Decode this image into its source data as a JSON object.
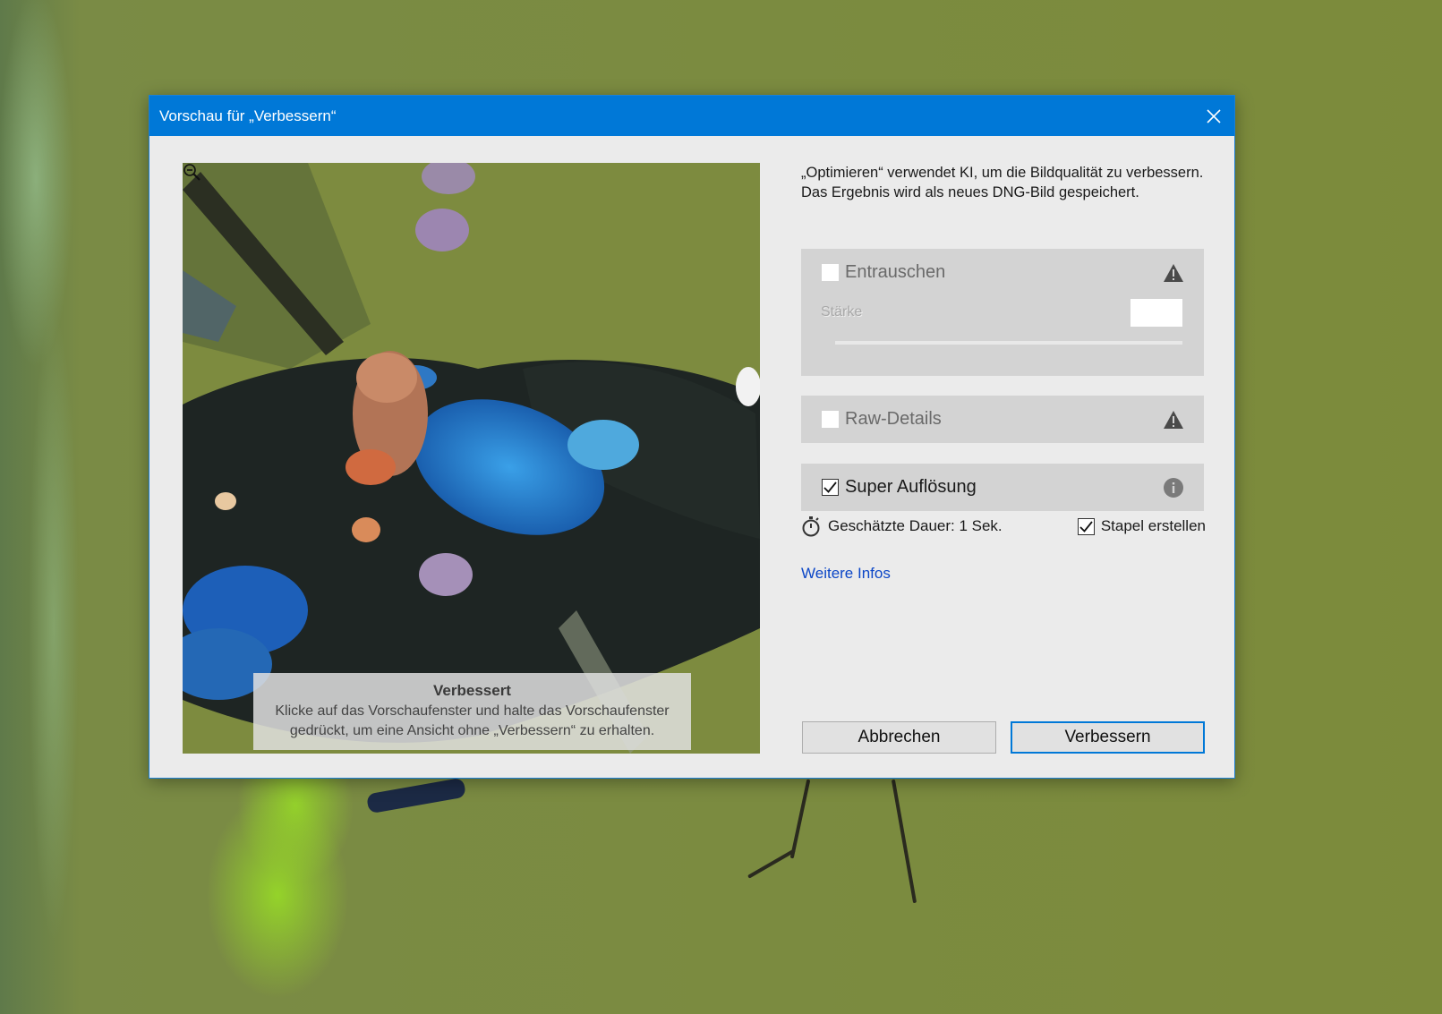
{
  "dialog": {
    "title": "Vorschau für „Verbessern“",
    "close_icon": "close-icon"
  },
  "preview": {
    "caption_title": "Verbessert",
    "caption_text_line1": "Klicke auf das Vorschaufenster und halte das Vorschaufenster",
    "caption_text_line2": "gedrückt, um eine Ansicht ohne „Verbessern“ zu erhalten.",
    "zoom_icon": "zoom-out-icon"
  },
  "intro": "„Optimieren“ verwendet KI, um die Bildqualität zu verbessern. Das Ergebnis wird als neues DNG-Bild gespeichert.",
  "options": {
    "denoise": {
      "label": "Entrauschen",
      "checked": false,
      "enabled": false,
      "icon": "warning-icon"
    },
    "strength": {
      "label": "Stärke",
      "value": ""
    },
    "raw_details": {
      "label": "Raw-Details",
      "checked": false,
      "enabled": false,
      "icon": "warning-icon"
    },
    "super_resolution": {
      "label": "Super Auflösung",
      "checked": true,
      "enabled": true,
      "icon": "info-icon"
    }
  },
  "duration": "Geschätzte Dauer: 1 Sek.",
  "stack": {
    "label": "Stapel erstellen",
    "checked": true
  },
  "more_info_link": "Weitere Infos",
  "buttons": {
    "cancel": "Abbrechen",
    "ok": "Verbessern"
  },
  "colors": {
    "titlebar": "#0078d7",
    "link": "#0b46c7",
    "dialog_bg": "#ebebeb",
    "panel_bg": "#d3d3d3"
  }
}
